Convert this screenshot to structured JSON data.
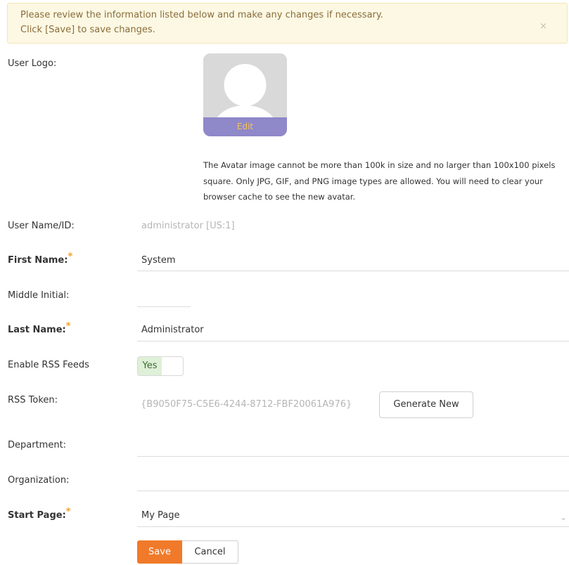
{
  "alert": {
    "line1": "Please review the information listed below and make any changes if necessary.",
    "line2": "Click [Save] to save changes.",
    "close": "×"
  },
  "form": {
    "user_logo_label": "User Logo:",
    "avatar_edit": "Edit",
    "avatar_help": "The Avatar image cannot be more than 100k in size and no larger than 100x100 pixels square. Only JPG, GIF, and PNG image types are allowed. You will need to clear your browser cache to see the new avatar.",
    "username_label": "User Name/ID:",
    "username_value": "administrator [US:1]",
    "first_name_label": "First Name:",
    "first_name_value": "System",
    "middle_initial_label": "Middle Initial:",
    "middle_initial_value": "",
    "last_name_label": "Last Name:",
    "last_name_value": "Administrator",
    "rss_enable_label": "Enable RSS Feeds",
    "rss_enable_value": "Yes",
    "rss_token_label": "RSS Token:",
    "rss_token_value": "{B9050F75-C5E6-4244-8712-FBF20061A976}",
    "generate_new": "Generate New",
    "department_label": "Department:",
    "department_value": "",
    "organization_label": "Organization:",
    "organization_value": "",
    "start_page_label": "Start Page:",
    "start_page_value": "My Page",
    "required_star": "*"
  },
  "actions": {
    "save": "Save",
    "cancel": "Cancel"
  },
  "colors": {
    "primary": "#f07a2a",
    "alert_bg": "#fcf8e3",
    "toggle_on": "#dff0d8"
  }
}
